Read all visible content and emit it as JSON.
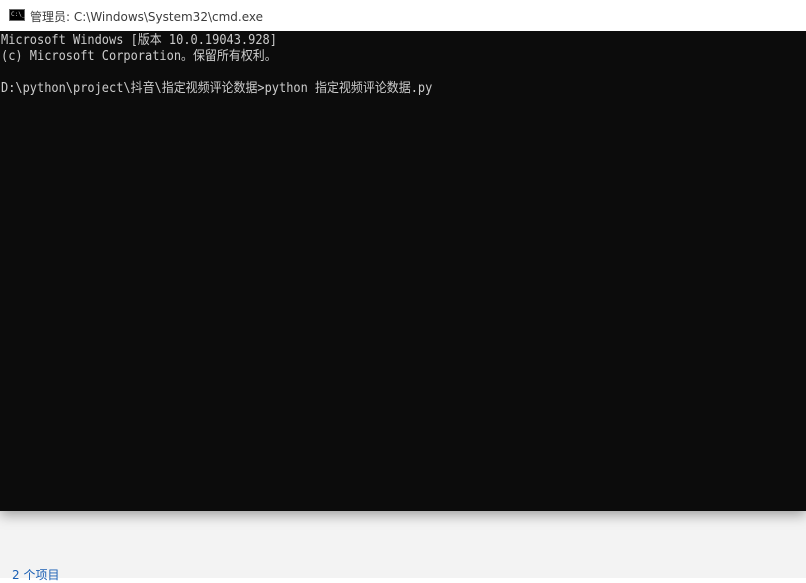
{
  "window": {
    "title": "管理员: C:\\Windows\\System32\\cmd.exe",
    "icon": "cmd-icon"
  },
  "console": {
    "lines": [
      "Microsoft Windows [版本 10.0.19043.928]",
      "(c) Microsoft Corporation。保留所有权利。",
      "D:\\python\\project\\抖音\\指定视频评论数据>python 指定视频评论数据.py"
    ],
    "text_color": "#cccccc",
    "background_color": "#0c0c0c"
  },
  "explorer": {
    "status_text": "2 个项目"
  }
}
